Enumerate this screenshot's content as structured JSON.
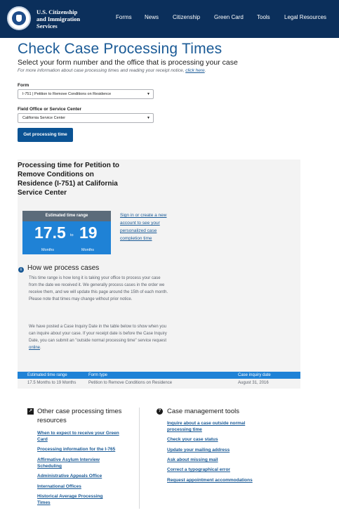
{
  "header": {
    "agency_line1": "U.S. Citizenship",
    "agency_line2": "and Immigration",
    "agency_line3": "Services",
    "nav": [
      "Forms",
      "News",
      "Citizenship",
      "Green Card",
      "Tools",
      "Legal Resources"
    ],
    "background_color": "#0b2f5b"
  },
  "page": {
    "title": "Check Case Processing Times",
    "subtitle": "Select your form number and the office that is processing your case",
    "more_info_text": "For more information about case processing times and reading your receipt notice,",
    "more_info_link": "click here",
    "more_info_period": "."
  },
  "form": {
    "form_label": "Form",
    "form_value": "I-751 | Petition to Remove Conditions on Residence",
    "office_label": "Field Office or Service Center",
    "office_value": "California Service Center",
    "submit_label": "Get processing time"
  },
  "result": {
    "title": "Processing time for Petition to Remove Conditions on Residence (I-751) at California Service Center",
    "range_header": "Estimated time range",
    "min": "17.5",
    "max": "19",
    "to": "to",
    "unit_min": "Months",
    "unit_max": "Months",
    "signin_text": "Sign in or create a new account to see your personalized case completion time",
    "how_title": "How we process cases",
    "para1": "This time range is how long it is taking your office to process your case from the date we received it. We generally process cases in the order we receive them, and we will update this page around the 15th of each month. Please note that times may change without prior notice.",
    "para2_text": "We have posted a Case Inquiry Date in the table below to show when you can inquire about your case. If your receipt date is before the Case Inquiry Date, you can submit an \"outside normal processing time\" service request",
    "para2_link": "online",
    "para2_period": ".",
    "table_headers": [
      "Estimated time range",
      "Form type",
      "Case inquiry date"
    ],
    "table_row": [
      "17.5 Months to 19 Months",
      "Petition to Remove Conditions on Residence",
      "August 31, 2016"
    ],
    "accent_color": "#1f82d6"
  },
  "resources": {
    "left_title": "Other case processing times resources",
    "left_links": [
      "When to expect to receive your Green Card",
      "Processing information for the I-765",
      "Affirmative Asylum Interview Scheduling",
      "Administrative Appeals Office",
      "International Offices",
      "Historical Average Processing Times"
    ],
    "right_title": "Case management tools",
    "right_links": [
      "Inquire about a case outside normal processing time",
      "Check your case status",
      "Update your mailing address",
      "Ask about missing mail",
      "Correct a typographical error",
      "Request appointment accommodations"
    ],
    "left_icon": "external-link-icon",
    "right_icon": "question-icon"
  }
}
